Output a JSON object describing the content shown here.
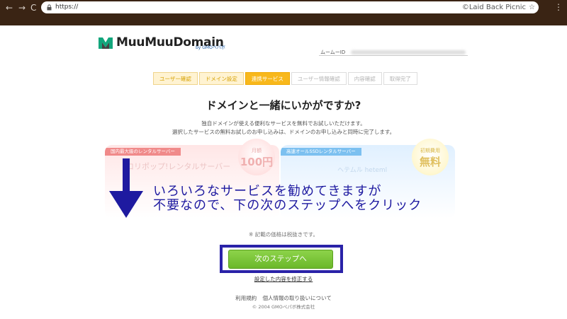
{
  "browser": {
    "back_icon": "←",
    "forward_icon": "→",
    "reload_icon": "C",
    "url": "https://",
    "watermark": "©Laid Back Picnic",
    "star_icon": "☆",
    "menu_icon": "⋮"
  },
  "header": {
    "logo_text": "MuuMuuDomain",
    "logo_sub": "by GMOペパボ",
    "user_id_label": "ムームーID"
  },
  "steps": [
    {
      "label": "ユーザー確認",
      "state": "done"
    },
    {
      "label": "ドメイン設定",
      "state": "done"
    },
    {
      "label": "連携サービス",
      "state": "active"
    },
    {
      "label": "ユーザー情報確認",
      "state": "todo"
    },
    {
      "label": "内容確認",
      "state": "todo"
    },
    {
      "label": "取得完了",
      "state": "todo"
    }
  ],
  "main": {
    "heading": "ドメインと一緒にいかがですか?",
    "desc_line1": "独自ドメインが使える便利なサービスを無料でお試しいただけます。",
    "desc_line2": "選択したサービスの無料お試しのお申し込みは、ドメインのお申し込みと同時に完了します。",
    "card_left_tag": "国内最大級のレンタルサーバー",
    "card_left_ghost": "ロリポップ!レンタルサーバー",
    "card_left_badge_top": "月額",
    "card_left_badge_value": "100円",
    "card_right_tag": "高速オールSSDレンタルサーバー",
    "card_right_ghost": "ヘテムル heteml",
    "card_right_badge_top": "初期費用",
    "card_right_badge_value": "無料",
    "overlay_line1": "いろいろなサービスを勧めてきますが",
    "overlay_line2": "不要なので、下の次のステップへをクリック",
    "tax_note": "※ 記載の価格は税抜きです。",
    "next_button": "次のステップへ",
    "modify_link": "設定した内容を修正する"
  },
  "footer": {
    "terms": "利用規約",
    "privacy": "個人情報の取り扱いについて",
    "copyright": "© 2004 GMOペパボ株式会社"
  },
  "colors": {
    "chrome_bg": "#3a2414",
    "step_active": "#f8b81c",
    "button_green": "#6bb82a",
    "annotation_blue": "#1e1aa0",
    "logo_green": "#12a67c"
  }
}
